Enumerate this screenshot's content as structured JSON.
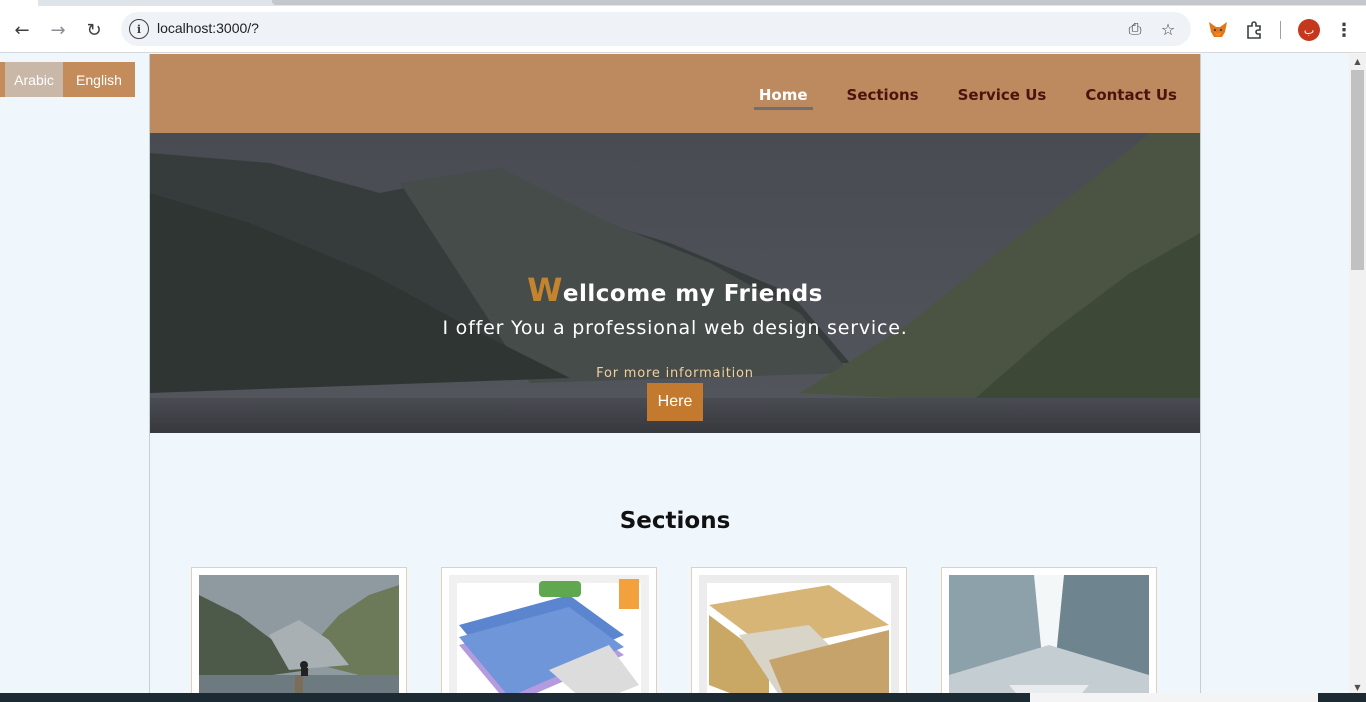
{
  "browser": {
    "url": "localhost:3000/?",
    "icons": [
      "back-icon",
      "forward-icon",
      "reload-icon",
      "site-info-icon",
      "install-icon",
      "bookmark-star-icon",
      "metamask-fox-icon",
      "extensions-puzzle-icon",
      "profile-avatar",
      "more-menu-icon"
    ],
    "profile_initial": "ب"
  },
  "lang_switch": {
    "arabic": "Arabic",
    "english": "English"
  },
  "nav": {
    "items": [
      {
        "label": "Home",
        "active": true
      },
      {
        "label": "Sections",
        "active": false
      },
      {
        "label": "Service Us",
        "active": false
      },
      {
        "label": "Contact Us",
        "active": false
      }
    ]
  },
  "hero": {
    "title_first_letter": "W",
    "title_rest": "ellcome my Friends",
    "subtitle": "I offer You a professional web design service.",
    "more_text": "For more informaition",
    "button": "Here"
  },
  "sections": {
    "title": "Sections",
    "cards": [
      "mountain-lake-image",
      "binders-image",
      "folder-documents-image",
      "architecture-image"
    ]
  },
  "colors": {
    "brand": "#bd8a60",
    "accent": "#c37a2e",
    "nav_text": "#4a130d",
    "page_bg": "#eff6fc"
  }
}
